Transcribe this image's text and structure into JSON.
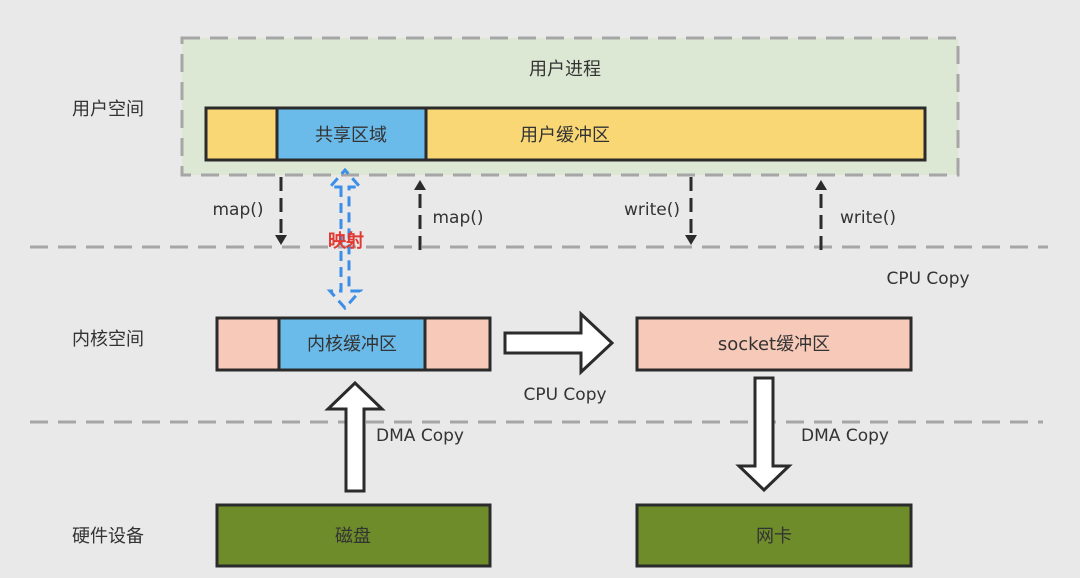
{
  "layers": {
    "user_space": "用户空间",
    "kernel_space": "内核空间",
    "hardware": "硬件设备"
  },
  "user_process": {
    "title": "用户进程",
    "shared_region": "共享区域",
    "user_buffer": "用户缓冲区"
  },
  "kernel": {
    "kernel_buffer": "内核缓冲区",
    "socket_buffer": "socket缓冲区"
  },
  "hardware": {
    "disk": "磁盘",
    "nic": "网卡"
  },
  "calls": {
    "map_down": "map()",
    "map_up": "map()",
    "write_down": "write()",
    "write_up": "write()"
  },
  "mapping_label": "映射",
  "copies": {
    "cpu_copy_top": "CPU Copy",
    "cpu_copy_middle": "CPU Copy",
    "dma_copy_left": "DMA Copy",
    "dma_copy_right": "DMA Copy"
  },
  "colors": {
    "background": "#e9e9e9",
    "user_region_fill": "#dce8d4",
    "yellow": "#f9d775",
    "blue": "#6bbbea",
    "pink": "#f6c9b9",
    "green": "#6e8c2a",
    "mapping_blue": "#3d8ee6",
    "mapping_red": "#e23a32"
  }
}
